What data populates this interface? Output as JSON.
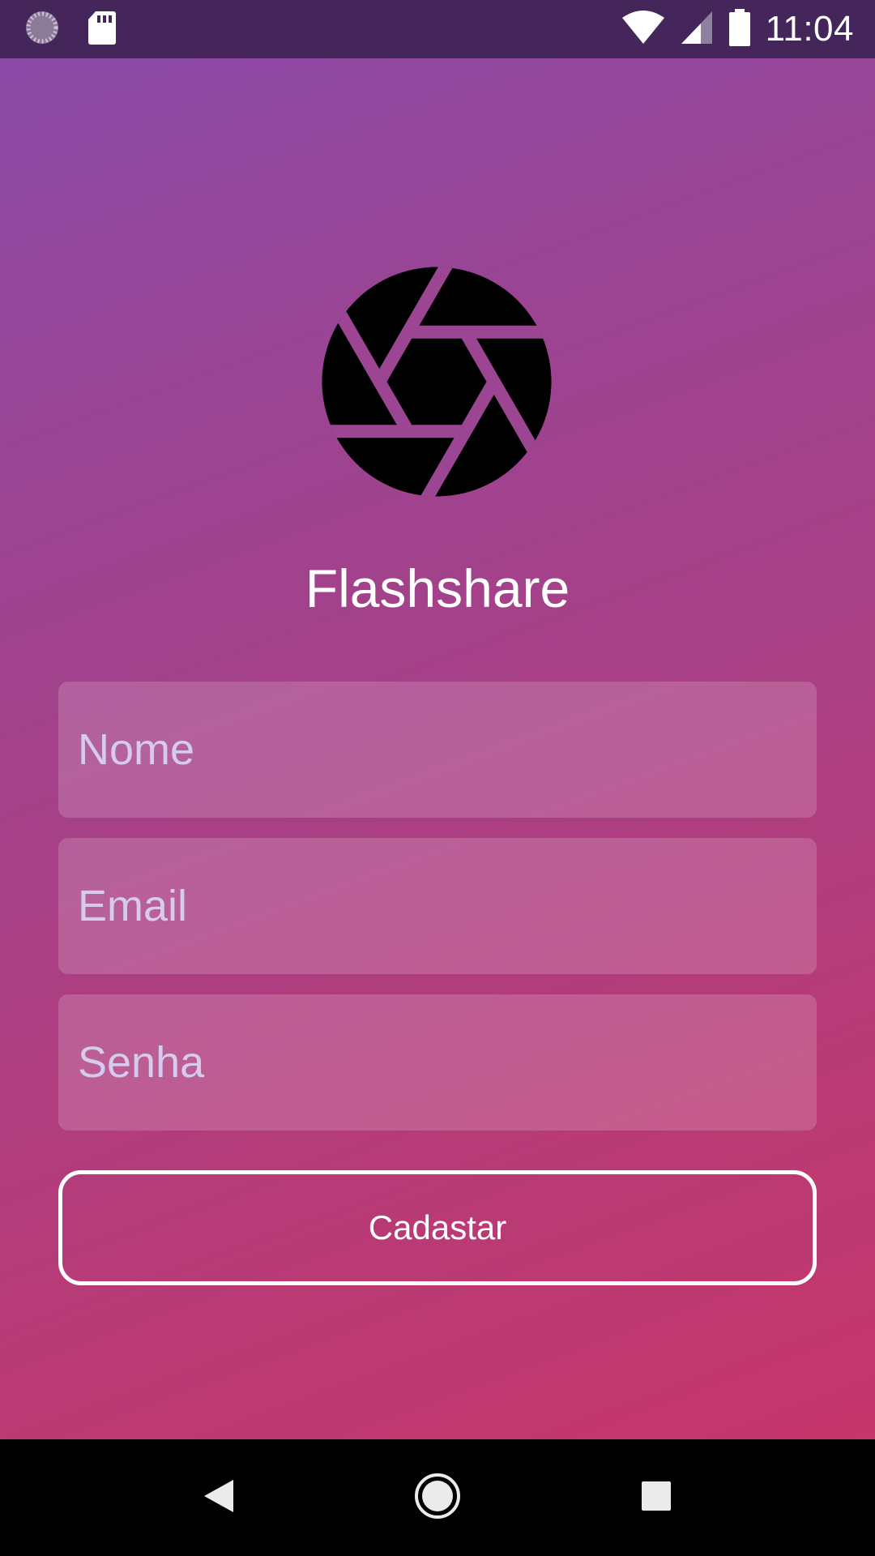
{
  "status_bar": {
    "time": "11:04",
    "icons": [
      "loading-spinner-icon",
      "sd-card-icon",
      "wifi-icon",
      "cell-signal-icon",
      "battery-icon"
    ]
  },
  "app": {
    "title": "Flashshare",
    "logo_icon": "camera-aperture-icon",
    "form": {
      "name_placeholder": "Nome",
      "email_placeholder": "Email",
      "password_placeholder": "Senha",
      "submit_label": "Cadastar"
    }
  },
  "nav_bar": {
    "buttons": [
      "back-icon",
      "home-icon",
      "recents-icon"
    ]
  },
  "colors": {
    "status_bar": "#45265a",
    "gradient_start": "#8a4aa6",
    "gradient_end": "#c5366a",
    "text": "#ffffff",
    "placeholder": "#d6cbee"
  }
}
